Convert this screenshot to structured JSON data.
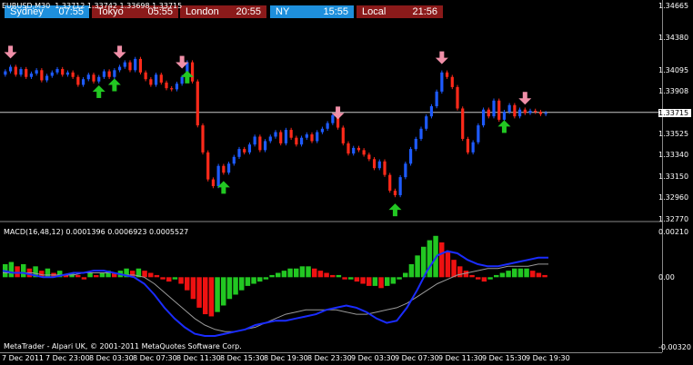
{
  "sessions": [
    {
      "name": "Sydney",
      "time": "07:55",
      "color": "#1e8fdc",
      "text_color": "#ffffff"
    },
    {
      "name": "Tokyo",
      "time": "05:55",
      "color": "#8b1a1a",
      "text_color": "#ffffff"
    },
    {
      "name": "London",
      "time": "20:55",
      "color": "#8b1a1a",
      "text_color": "#ffffff"
    },
    {
      "name": "NY",
      "time": "15:55",
      "color": "#1e8fdc",
      "text_color": "#ffffff"
    },
    {
      "name": "Local",
      "time": "21:56",
      "color": "#8b1a1a",
      "text_color": "#ffffff"
    }
  ],
  "symbol_line": "EURUSD,M30  1.33712 1.33742 1.33698 1.33715",
  "macd_line": "MACD(16,48,12) 0.0001396 0.0006923 0.0005527",
  "copyright": "MetaTrader - Alpari UK, © 2001-2011 MetaQuotes Software Corp.",
  "colors": {
    "background": "#000000",
    "bull": "#1e5bff",
    "bear": "#ff2a1a",
    "macd_up": "#22c722",
    "macd_down": "#ee1111",
    "signal_line": "#1a2cff",
    "slow_line": "#9a9a9a",
    "arrow_down": "#f08fa8",
    "arrow_up": "#22c722",
    "current_price_line": "#c8c8c8"
  },
  "chart_data": [
    {
      "type": "candlestick",
      "title": "EURUSD,M30",
      "ohlc_text": "1.33712 1.33742 1.33698 1.33715",
      "current_price": 1.33715,
      "y_ticks": [
        "1.34665",
        "1.34380",
        "1.34095",
        "1.33908",
        "1.33715",
        "1.33525",
        "1.33340",
        "1.33150",
        "1.32960",
        "1.32770"
      ],
      "ylim": [
        1.3277,
        1.34665
      ],
      "x_ticks": [
        "7 Dec 2011",
        "7 Dec 23:00",
        "8 Dec 03:30",
        "8 Dec 07:30",
        "8 Dec 11:30",
        "8 Dec 15:30",
        "8 Dec 19:30",
        "8 Dec 23:30",
        "9 Dec 03:30",
        "9 Dec 07:30",
        "9 Dec 11:30",
        "9 Dec 15:30",
        "9 Dec 19:30"
      ],
      "closes": [
        1.3408,
        1.3412,
        1.3405,
        1.341,
        1.3403,
        1.3406,
        1.3409,
        1.34,
        1.3404,
        1.3407,
        1.341,
        1.3405,
        1.3407,
        1.3403,
        1.3396,
        1.3401,
        1.3405,
        1.3399,
        1.3403,
        1.3408,
        1.3403,
        1.3409,
        1.3412,
        1.3416,
        1.3409,
        1.3419,
        1.3407,
        1.3401,
        1.3396,
        1.3405,
        1.3398,
        1.3393,
        1.3392,
        1.3397,
        1.3403,
        1.3416,
        1.3399,
        1.336,
        1.3336,
        1.3312,
        1.3306,
        1.3324,
        1.3318,
        1.3326,
        1.3332,
        1.3339,
        1.3336,
        1.3343,
        1.335,
        1.3338,
        1.3346,
        1.335,
        1.3354,
        1.3344,
        1.3356,
        1.3349,
        1.3343,
        1.3349,
        1.3352,
        1.3346,
        1.3354,
        1.3357,
        1.3362,
        1.3369,
        1.3358,
        1.3344,
        1.3335,
        1.334,
        1.3338,
        1.3334,
        1.333,
        1.3322,
        1.3328,
        1.3316,
        1.3302,
        1.3298,
        1.3314,
        1.3326,
        1.3339,
        1.3348,
        1.3357,
        1.3368,
        1.3377,
        1.339,
        1.3407,
        1.3403,
        1.3394,
        1.3375,
        1.3348,
        1.3336,
        1.3345,
        1.336,
        1.3374,
        1.3368,
        1.3382,
        1.3365,
        1.3372,
        1.3378,
        1.3368,
        1.3374,
        1.3371,
        1.3373,
        1.3372,
        1.337,
        1.3371
      ]
    },
    {
      "type": "bar",
      "title": "MACD(16,48,12)",
      "values_text": "0.0001396 0.0006923 0.0005527",
      "y_ticks": [
        "0.00210",
        "0.00",
        "-0.00320"
      ],
      "ylim": [
        -0.0032,
        0.0021
      ],
      "histogram": [
        0.0006,
        0.0007,
        0.0005,
        0.0006,
        0.0004,
        0.0005,
        0.0003,
        0.0004,
        0.0002,
        0.0003,
        0.0001,
        0.0002,
        0.0001,
        -0.0001,
        0.0002,
        0.0001,
        0.0002,
        0.0003,
        0.0002,
        0.0003,
        0.0004,
        0.0003,
        0.0004,
        0.0003,
        0.0002,
        0.0001,
        -0.0001,
        -0.0002,
        -0.0001,
        -0.0003,
        -0.0006,
        -0.001,
        -0.0014,
        -0.0017,
        -0.0018,
        -0.0016,
        -0.0013,
        -0.001,
        -0.0008,
        -0.0006,
        -0.0004,
        -0.0003,
        -0.0002,
        -0.0001,
        0.0001,
        0.0002,
        0.0003,
        0.0004,
        0.0004,
        0.0005,
        0.0005,
        0.0004,
        0.0003,
        0.0002,
        0.0001,
        0.0001,
        -0.0001,
        -0.0001,
        -0.0002,
        -0.0003,
        -0.0004,
        -0.0004,
        -0.0005,
        -0.0004,
        -0.0003,
        -0.0001,
        0.0002,
        0.0006,
        0.001,
        0.0014,
        0.0017,
        0.0019,
        0.0016,
        0.0012,
        0.0008,
        0.0005,
        0.0003,
        0.0001,
        -0.0001,
        -0.0002,
        -0.0001,
        0.0001,
        0.0002,
        0.0003,
        0.0004,
        0.0004,
        0.0004,
        0.0003,
        0.0002,
        0.0001
      ],
      "macd_line": [
        0.0003,
        0.0002,
        0.0002,
        0.0001,
        0.0,
        0.0,
        0.0001,
        0.0002,
        0.0002,
        0.0003,
        0.0003,
        0.0002,
        0.0001,
        0.0,
        -0.0003,
        -0.0008,
        -0.0014,
        -0.0019,
        -0.0023,
        -0.0026,
        -0.0027,
        -0.0027,
        -0.0026,
        -0.0025,
        -0.0024,
        -0.0022,
        -0.0021,
        -0.002,
        -0.002,
        -0.0019,
        -0.0018,
        -0.0017,
        -0.0015,
        -0.0014,
        -0.0013,
        -0.0014,
        -0.0016,
        -0.0019,
        -0.0021,
        -0.002,
        -0.0014,
        -0.0006,
        0.0003,
        0.001,
        0.0012,
        0.0011,
        0.0008,
        0.0006,
        0.0005,
        0.0005,
        0.0006,
        0.0007,
        0.0008,
        0.0009,
        0.0009
      ],
      "slow_line": [
        0.0002,
        0.0002,
        0.0002,
        0.0002,
        0.0001,
        0.0001,
        0.0001,
        0.0001,
        0.0002,
        0.0002,
        0.0002,
        0.0002,
        0.0001,
        0.0001,
        0.0,
        -0.0003,
        -0.0007,
        -0.0011,
        -0.0015,
        -0.0019,
        -0.0022,
        -0.0024,
        -0.0025,
        -0.0025,
        -0.0024,
        -0.0023,
        -0.0021,
        -0.0019,
        -0.0017,
        -0.0016,
        -0.0015,
        -0.0015,
        -0.0015,
        -0.0015,
        -0.0016,
        -0.0017,
        -0.0017,
        -0.0016,
        -0.0015,
        -0.0014,
        -0.0012,
        -0.0009,
        -0.0006,
        -0.0003,
        -0.0001,
        0.0001,
        0.0002,
        0.0003,
        0.0004,
        0.0004,
        0.0005,
        0.0005,
        0.0005,
        0.0006,
        0.0006
      ]
    }
  ]
}
